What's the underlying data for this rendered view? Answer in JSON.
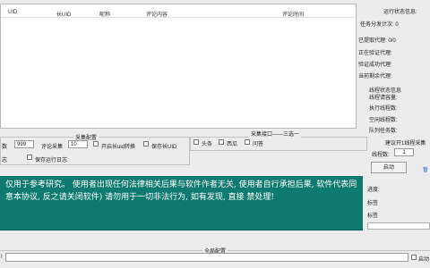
{
  "table": {
    "columns": [
      "UID",
      "长UID",
      "昵称",
      "评论内容",
      "评论时间"
    ]
  },
  "status": {
    "title": "运行状态信息:",
    "task_total": "任务分发计次: 0",
    "proxy": {
      "taken": "已提取代理: 0/0",
      "verifying": "正在验证代理:",
      "verified": "验证成功代理:",
      "remaining": "当前剩余代理:"
    },
    "thread_title": "线程状态信息",
    "threads": {
      "requesting": "线程请容量:",
      "running": "执行线程数:",
      "idle": "空闲线程数:",
      "queue": "队列任务数:"
    }
  },
  "collect": {
    "legend": "采集配置",
    "count_label": "数",
    "count_value": "999",
    "comment_label": "评论采集",
    "comment_value": "10",
    "longuid_label": "开启长uid转换",
    "save_longuid_label": "保存长UID",
    "log_label": "志",
    "save_log_label": "保存运行日志"
  },
  "interface": {
    "legend": "采集接口——三选一",
    "options": [
      "头条",
      "西瓜",
      "问答"
    ]
  },
  "multithread": {
    "title": "建议开1线程采集",
    "threads_label": "线程数:",
    "threads_value": "1",
    "start_label": "启动",
    "pause_label": "暂"
  },
  "progress": {
    "label": "进度:",
    "tag1": "标签",
    "tag2": "标签"
  },
  "notice": {
    "text": "仅用于参考研究。 使用者出现任何法律相关后果与软件作者无关, 使用者自行承担后果, 软件代表同意本协议, 反之请关闭软件) 请勿用于一切非法行为, 如有发现, 直接 禁处理!"
  },
  "global": {
    "legend": "全局配置",
    "field_prefix": "I",
    "autorun_label": "启动"
  }
}
